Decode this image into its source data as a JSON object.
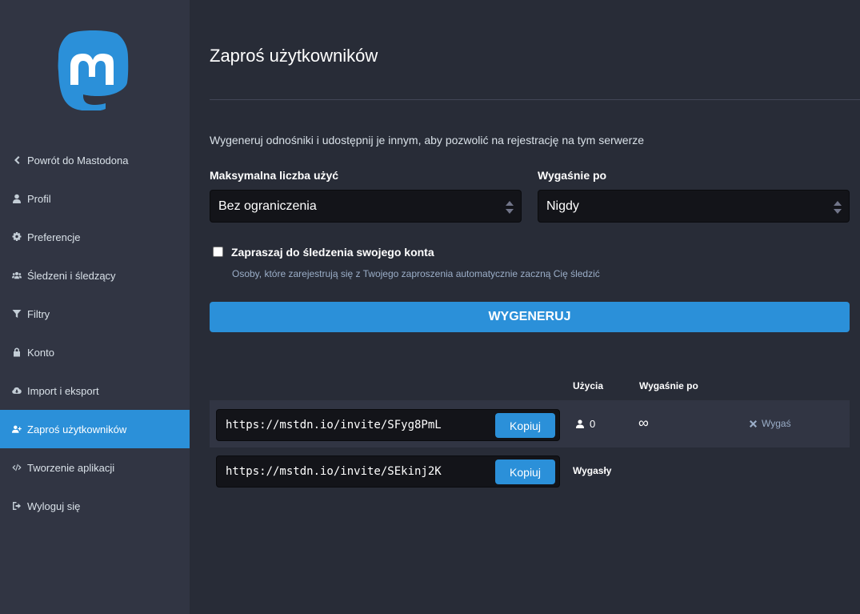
{
  "sidebar": {
    "logo": "mastodon-logo",
    "items": [
      {
        "label": "Powrót do Mastodona",
        "icon": "chevron-left-icon",
        "active": false
      },
      {
        "label": "Profil",
        "icon": "user-icon",
        "active": false
      },
      {
        "label": "Preferencje",
        "icon": "cog-icon",
        "active": false
      },
      {
        "label": "Śledzeni i śledzący",
        "icon": "users-icon",
        "active": false
      },
      {
        "label": "Filtry",
        "icon": "filter-icon",
        "active": false
      },
      {
        "label": "Konto",
        "icon": "lock-icon",
        "active": false
      },
      {
        "label": "Import i eksport",
        "icon": "cloud-download-icon",
        "active": false
      },
      {
        "label": "Zaproś użytkowników",
        "icon": "user-plus-icon",
        "active": true
      },
      {
        "label": "Tworzenie aplikacji",
        "icon": "code-icon",
        "active": false
      },
      {
        "label": "Wyloguj się",
        "icon": "sign-out-icon",
        "active": false
      }
    ]
  },
  "main": {
    "title": "Zaproś użytkowników",
    "lead": "Wygeneruj odnośniki i udostępnij je innym, aby pozwolić na rejestrację na tym serwerze",
    "max_uses": {
      "label": "Maksymalna liczba użyć",
      "value": "Bez ograniczenia"
    },
    "expires_in": {
      "label": "Wygaśnie po",
      "value": "Nigdy"
    },
    "autofollow": {
      "label": "Zapraszaj do śledzenia swojego konta",
      "hint": "Osoby, które zarejestrują się z Twojego zaproszenia automatycznie zaczną Cię śledzić",
      "checked": false
    },
    "generate_button": "WYGENERUJ"
  },
  "table": {
    "headers": {
      "uses": "Użycia",
      "expires": "Wygaśnie po"
    },
    "rows": [
      {
        "link": "https://mstdn.io/invite/SFyg8PmL",
        "copy": "Kopiuj",
        "uses": "0",
        "expires": "∞",
        "action": "Wygaś"
      },
      {
        "link": "https://mstdn.io/invite/SEkinj2K",
        "copy": "Kopiuj",
        "status": "Wygasły"
      }
    ]
  },
  "colors": {
    "accent": "#2b90d9",
    "background": "#282c37",
    "sidebar": "#313543"
  }
}
